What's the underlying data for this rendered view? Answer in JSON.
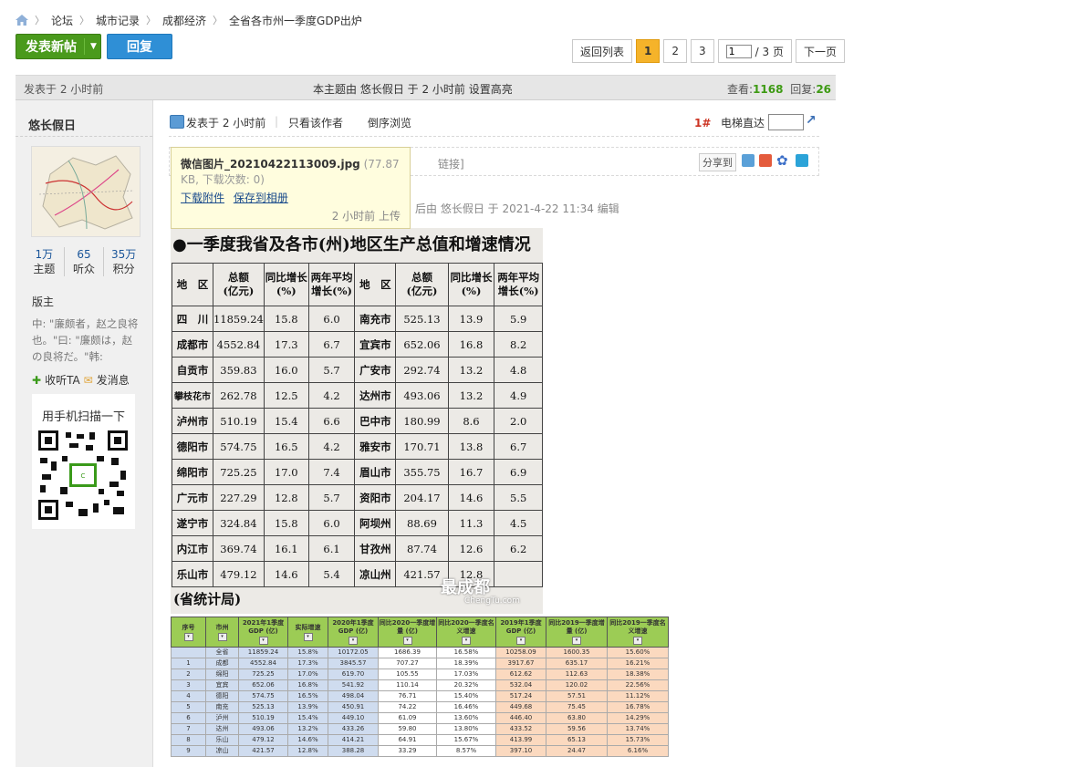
{
  "breadcrumb": [
    "论坛",
    "城市记录",
    "成都经济",
    "全省各市州一季度GDP出炉"
  ],
  "buttons": {
    "new_post": "发表新帖",
    "reply": "回复"
  },
  "pager": {
    "back": "返回列表",
    "pages": [
      "1",
      "2",
      "3"
    ],
    "current_input": "1",
    "total": "/ 3 页",
    "next": "下一页"
  },
  "infobar": {
    "posted": "发表于 2 小时前",
    "note": "本主题由 悠长假日 于 2 小时前 设置高亮",
    "views_label": "查看:",
    "views": "1168",
    "replies_label": "回复:",
    "replies": "26"
  },
  "author": {
    "name": "悠长假日",
    "stats": [
      {
        "value": "1万",
        "label": "主题"
      },
      {
        "value": "65",
        "label": "听众"
      },
      {
        "value": "35万",
        "label": "积分"
      }
    ],
    "role": "版主",
    "signature": "中: \"廉颇者，赵之良将也。\"曰: \"廉颇は，赵の良将だ。\"韩:",
    "follow": "收听TA",
    "message": "发消息",
    "qr_title": "用手机扫描一下"
  },
  "post_tools": {
    "posted": "发表于 2 小时前",
    "author_only": "只看该作者",
    "reverse": "倒序浏览",
    "floor": "1#",
    "jump": "电梯直达"
  },
  "share": {
    "label": "分享到",
    "link_tail": "链接]"
  },
  "tooltip": {
    "filename": "微信图片_20210422113009.jpg",
    "meta": "(77.87 KB, 下载次数: 0)",
    "download": "下载附件",
    "save": "保存到相册",
    "uploaded": "2 小时前 上传"
  },
  "edit_note": "后由 悠长假日 于 2021-4-22 11:34 编辑",
  "photo": {
    "title": "●一季度我省及各市(州)地区生产总值和增速情况",
    "headers": [
      "地　区",
      "总额\n(亿元)",
      "同比增长\n(%)",
      "两年平均\n增长(%)",
      "地　区",
      "总额\n(亿元)",
      "同比增长\n(%)",
      "两年平均\n增长(%)"
    ],
    "rows": [
      [
        "四　川",
        "11859.24",
        "15.8",
        "6.0",
        "南充市",
        "525.13",
        "13.9",
        "5.9"
      ],
      [
        "成都市",
        "4552.84",
        "17.3",
        "6.7",
        "宜宾市",
        "652.06",
        "16.8",
        "8.2"
      ],
      [
        "自贡市",
        "359.83",
        "16.0",
        "5.7",
        "广安市",
        "292.74",
        "13.2",
        "4.8"
      ],
      [
        "攀枝花市",
        "262.78",
        "12.5",
        "4.2",
        "达州市",
        "493.06",
        "13.2",
        "4.9"
      ],
      [
        "泸州市",
        "510.19",
        "15.4",
        "6.6",
        "巴中市",
        "180.99",
        "8.6",
        "2.0"
      ],
      [
        "德阳市",
        "574.75",
        "16.5",
        "4.2",
        "雅安市",
        "170.71",
        "13.8",
        "6.7"
      ],
      [
        "绵阳市",
        "725.25",
        "17.0",
        "7.4",
        "眉山市",
        "355.75",
        "16.7",
        "6.9"
      ],
      [
        "广元市",
        "227.29",
        "12.8",
        "5.7",
        "资阳市",
        "204.17",
        "14.6",
        "5.5"
      ],
      [
        "遂宁市",
        "324.84",
        "15.8",
        "6.0",
        "阿坝州",
        "88.69",
        "11.3",
        "4.5"
      ],
      [
        "内江市",
        "369.74",
        "16.1",
        "6.1",
        "甘孜州",
        "87.74",
        "12.6",
        "6.2"
      ],
      [
        "乐山市",
        "479.12",
        "14.6",
        "5.4",
        "凉山州",
        "421.57",
        "12.8",
        ""
      ]
    ],
    "source": "(省统计局)",
    "watermark": "最成都",
    "watermark_url": "ChengTu.com"
  },
  "excel": {
    "headers": [
      "序号",
      "市州",
      "2021年1季度GDP (亿)",
      "实际增速",
      "2020年1季度GDP (亿)",
      "同比2020一季度增量 (亿)",
      "同比2020一季度名义增速",
      "2019年1季度GDP (亿)",
      "同比2019一季度增量 (亿)",
      "同比2019一季度名义增速"
    ],
    "rows": [
      [
        "",
        "全省",
        "11859.24",
        "15.8%",
        "10172.05",
        "1686.39",
        "16.58%",
        "10258.09",
        "1600.35",
        "15.60%"
      ],
      [
        "1",
        "成都",
        "4552.84",
        "17.3%",
        "3845.57",
        "707.27",
        "18.39%",
        "3917.67",
        "635.17",
        "16.21%"
      ],
      [
        "2",
        "绵阳",
        "725.25",
        "17.0%",
        "619.70",
        "105.55",
        "17.03%",
        "612.62",
        "112.63",
        "18.38%"
      ],
      [
        "3",
        "宜宾",
        "652.06",
        "16.8%",
        "541.92",
        "110.14",
        "20.32%",
        "532.04",
        "120.02",
        "22.56%"
      ],
      [
        "4",
        "德阳",
        "574.75",
        "16.5%",
        "498.04",
        "76.71",
        "15.40%",
        "517.24",
        "57.51",
        "11.12%"
      ],
      [
        "5",
        "南充",
        "525.13",
        "13.9%",
        "450.91",
        "74.22",
        "16.46%",
        "449.68",
        "75.45",
        "16.78%"
      ],
      [
        "6",
        "泸州",
        "510.19",
        "15.4%",
        "449.10",
        "61.09",
        "13.60%",
        "446.40",
        "63.80",
        "14.29%"
      ],
      [
        "7",
        "达州",
        "493.06",
        "13.2%",
        "433.26",
        "59.80",
        "13.80%",
        "433.52",
        "59.56",
        "13.74%"
      ],
      [
        "8",
        "乐山",
        "479.12",
        "14.6%",
        "414.21",
        "64.91",
        "15.67%",
        "413.99",
        "65.13",
        "15.73%"
      ],
      [
        "9",
        "凉山",
        "421.57",
        "12.8%",
        "388.28",
        "33.29",
        "8.57%",
        "397.10",
        "24.47",
        "6.16%"
      ]
    ]
  },
  "colors": {
    "green_button": "#4a9a1c",
    "blue_button": "#2f8fd6",
    "current_page": "#f5b32a",
    "excel_header": "#9ccc55",
    "excel_blue": "#cfdcef",
    "excel_peach": "#fbd9bf"
  }
}
